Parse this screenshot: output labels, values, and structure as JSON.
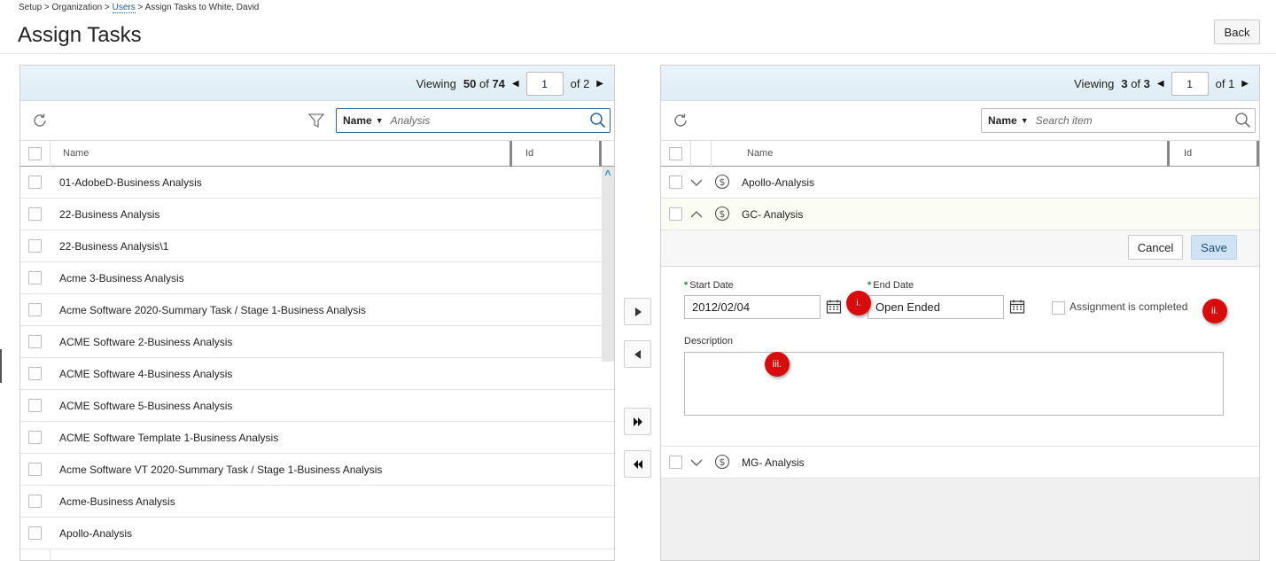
{
  "breadcrumb": {
    "part1": "Setup > Organization > ",
    "link": "Users",
    "part2": " > Assign Tasks to White, David"
  },
  "page_title": "Assign Tasks",
  "back_label": "Back",
  "left_panel": {
    "viewing_label": "Viewing",
    "viewing_count": "50",
    "of_word": "of",
    "total": "74",
    "page": "1",
    "of_pages": "of 2",
    "search_field": "Name",
    "search_value": "Analysis",
    "columns": {
      "name": "Name",
      "id": "Id"
    },
    "rows": [
      "01-AdobeD-Business Analysis",
      "22-Business Analysis",
      "22-Business Analysis\\1",
      "Acme 3-Business Analysis",
      "Acme Software 2020-Summary Task / Stage 1-Business Analysis",
      "ACME Software 2-Business Analysis",
      "ACME Software 4-Business Analysis",
      "ACME Software 5-Business Analysis",
      "ACME Software Template 1-Business Analysis",
      "Acme Software VT 2020-Summary Task / Stage 1-Business Analysis",
      "Acme-Business Analysis",
      "Apollo-Analysis"
    ]
  },
  "right_panel": {
    "viewing_label": "Viewing",
    "viewing_count": "3",
    "of_word": "of",
    "total": "3",
    "page": "1",
    "of_pages": "of 1",
    "search_field": "Name",
    "search_placeholder": "Search item",
    "columns": {
      "name": "Name",
      "id": "Id"
    },
    "rows": [
      "Apollo-Analysis",
      "GC- Analysis",
      "MG- Analysis"
    ],
    "form": {
      "cancel_label": "Cancel",
      "save_label": "Save",
      "start_date_label": "Start Date",
      "start_date_value": "2012/02/04",
      "end_date_label": "End Date",
      "end_date_value": "Open Ended",
      "completed_label": "Assignment is completed",
      "description_label": "Description",
      "required_mark": "*"
    }
  },
  "markers": [
    "i.",
    "ii.",
    "iii."
  ],
  "colors": {
    "marker": "#d90b0b",
    "accent": "#2a6aa6",
    "required": "#1c8a3c",
    "pager_bg": "#e4f0f8"
  }
}
